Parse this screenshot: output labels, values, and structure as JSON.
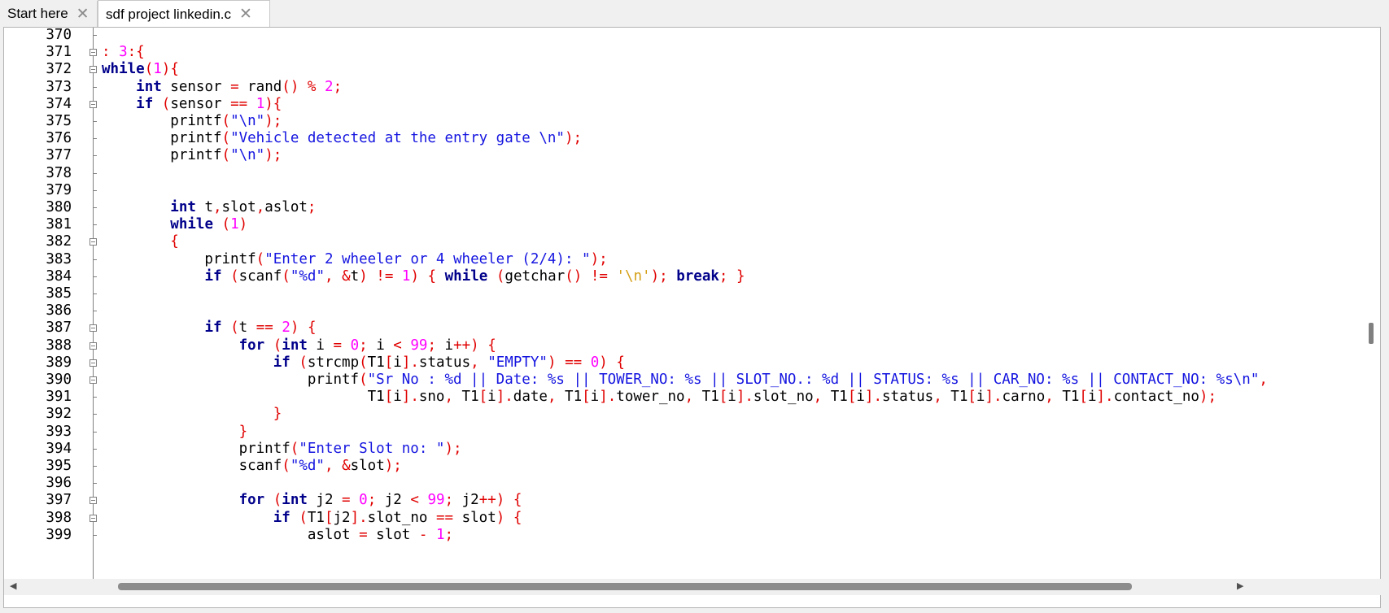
{
  "tabs": [
    {
      "label": "Start here",
      "active": false
    },
    {
      "label": "sdf project linkedin.c",
      "active": true
    }
  ],
  "close_glyph": "✕",
  "editor": {
    "lines": [
      {
        "n": "370",
        "html": ""
      },
      {
        "n": "371",
        "html": "<span class=\"op\">:</span> <span class=\"num\">3</span><span class=\"op\">:{</span>"
      },
      {
        "n": "372",
        "html": "<span class=\"kw\">while</span><span class=\"op\">(</span><span class=\"num\">1</span><span class=\"op\">){</span>"
      },
      {
        "n": "373",
        "html": "    <span class=\"kw\">int</span> sensor <span class=\"op\">=</span> rand<span class=\"op\">()</span> <span class=\"op\">%</span> <span class=\"num\">2</span><span class=\"op\">;</span>"
      },
      {
        "n": "374",
        "html": "    <span class=\"kw\">if</span> <span class=\"op\">(</span>sensor <span class=\"op\">==</span> <span class=\"num\">1</span><span class=\"op\">){</span>"
      },
      {
        "n": "375",
        "html": "        printf<span class=\"op\">(</span><span class=\"str\">\"\\n\"</span><span class=\"op\">);</span>"
      },
      {
        "n": "376",
        "html": "        printf<span class=\"op\">(</span><span class=\"str\">\"Vehicle detected at the entry gate \\n\"</span><span class=\"op\">);</span>"
      },
      {
        "n": "377",
        "html": "        printf<span class=\"op\">(</span><span class=\"str\">\"\\n\"</span><span class=\"op\">);</span>"
      },
      {
        "n": "378",
        "html": ""
      },
      {
        "n": "379",
        "html": ""
      },
      {
        "n": "380",
        "html": "        <span class=\"kw\">int</span> t<span class=\"op\">,</span>slot<span class=\"op\">,</span>aslot<span class=\"op\">;</span>"
      },
      {
        "n": "381",
        "html": "        <span class=\"kw\">while</span> <span class=\"op\">(</span><span class=\"num\">1</span><span class=\"op\">)</span>"
      },
      {
        "n": "382",
        "html": "        <span class=\"op\">{</span>"
      },
      {
        "n": "383",
        "html": "            printf<span class=\"op\">(</span><span class=\"str\">\"Enter 2 wheeler or 4 wheeler (2/4): \"</span><span class=\"op\">);</span>"
      },
      {
        "n": "384",
        "html": "            <span class=\"kw\">if</span> <span class=\"op\">(</span>scanf<span class=\"op\">(</span><span class=\"str\">\"%d\"</span><span class=\"op\">,</span> <span class=\"op\">&amp;</span>t<span class=\"op\">)</span> <span class=\"op\">!=</span> <span class=\"num\">1</span><span class=\"op\">)</span> <span class=\"op\">{</span> <span class=\"kw\">while</span> <span class=\"op\">(</span>getchar<span class=\"op\">()</span> <span class=\"op\">!=</span> <span class=\"chr\">'\\n'</span><span class=\"op\">);</span> <span class=\"kw\">break</span><span class=\"op\">;</span> <span class=\"op\">}</span>"
      },
      {
        "n": "385",
        "html": ""
      },
      {
        "n": "386",
        "html": ""
      },
      {
        "n": "387",
        "html": "            <span class=\"kw\">if</span> <span class=\"op\">(</span>t <span class=\"op\">==</span> <span class=\"num\">2</span><span class=\"op\">)</span> <span class=\"op\">{</span>"
      },
      {
        "n": "388",
        "html": "                <span class=\"kw\">for</span> <span class=\"op\">(</span><span class=\"kw\">int</span> i <span class=\"op\">=</span> <span class=\"num\">0</span><span class=\"op\">;</span> i <span class=\"op\">&lt;</span> <span class=\"num\">99</span><span class=\"op\">;</span> i<span class=\"op\">++)</span> <span class=\"op\">{</span>"
      },
      {
        "n": "389",
        "html": "                    <span class=\"kw\">if</span> <span class=\"op\">(</span>strcmp<span class=\"op\">(</span>T1<span class=\"op\">[</span>i<span class=\"op\">].</span>status<span class=\"op\">,</span> <span class=\"str\">\"EMPTY\"</span><span class=\"op\">)</span> <span class=\"op\">==</span> <span class=\"num\">0</span><span class=\"op\">)</span> <span class=\"op\">{</span>"
      },
      {
        "n": "390",
        "html": "                        printf<span class=\"op\">(</span><span class=\"str\">\"Sr No : %d || Date: %s || TOWER_NO: %s || SLOT_NO.: %d || STATUS: %s || CAR_NO: %s || CONTACT_NO: %s\\n\"</span><span class=\"op\">,</span>"
      },
      {
        "n": "391",
        "html": "                               T1<span class=\"op\">[</span>i<span class=\"op\">].</span>sno<span class=\"op\">,</span> T1<span class=\"op\">[</span>i<span class=\"op\">].</span>date<span class=\"op\">,</span> T1<span class=\"op\">[</span>i<span class=\"op\">].</span>tower_no<span class=\"op\">,</span> T1<span class=\"op\">[</span>i<span class=\"op\">].</span>slot_no<span class=\"op\">,</span> T1<span class=\"op\">[</span>i<span class=\"op\">].</span>status<span class=\"op\">,</span> T1<span class=\"op\">[</span>i<span class=\"op\">].</span>carno<span class=\"op\">,</span> T1<span class=\"op\">[</span>i<span class=\"op\">].</span>contact_no<span class=\"op\">);</span>"
      },
      {
        "n": "392",
        "html": "                    <span class=\"op\">}</span>"
      },
      {
        "n": "393",
        "html": "                <span class=\"op\">}</span>"
      },
      {
        "n": "394",
        "html": "                printf<span class=\"op\">(</span><span class=\"str\">\"Enter Slot no: \"</span><span class=\"op\">);</span>"
      },
      {
        "n": "395",
        "html": "                scanf<span class=\"op\">(</span><span class=\"str\">\"%d\"</span><span class=\"op\">,</span> <span class=\"op\">&amp;</span>slot<span class=\"op\">);</span>"
      },
      {
        "n": "396",
        "html": ""
      },
      {
        "n": "397",
        "html": "                <span class=\"kw\">for</span> <span class=\"op\">(</span><span class=\"kw\">int</span> j2 <span class=\"op\">=</span> <span class=\"num\">0</span><span class=\"op\">;</span> j2 <span class=\"op\">&lt;</span> <span class=\"num\">99</span><span class=\"op\">;</span> j2<span class=\"op\">++)</span> <span class=\"op\">{</span>"
      },
      {
        "n": "398",
        "html": "                    <span class=\"kw\">if</span> <span class=\"op\">(</span>T1<span class=\"op\">[</span>j2<span class=\"op\">].</span>slot_no <span class=\"op\">==</span> slot<span class=\"op\">)</span> <span class=\"op\">{</span>"
      },
      {
        "n": "399",
        "html": "                        aslot <span class=\"op\">=</span> slot <span class=\"op\">-</span> <span class=\"num\">1</span><span class=\"op\">;</span>"
      }
    ],
    "fold_lines": [
      "371",
      "372",
      "374",
      "382",
      "387",
      "388",
      "389",
      "390",
      "397",
      "398"
    ]
  },
  "scrollbar": {
    "left_arrow": "◀",
    "right_arrow": "▶"
  }
}
